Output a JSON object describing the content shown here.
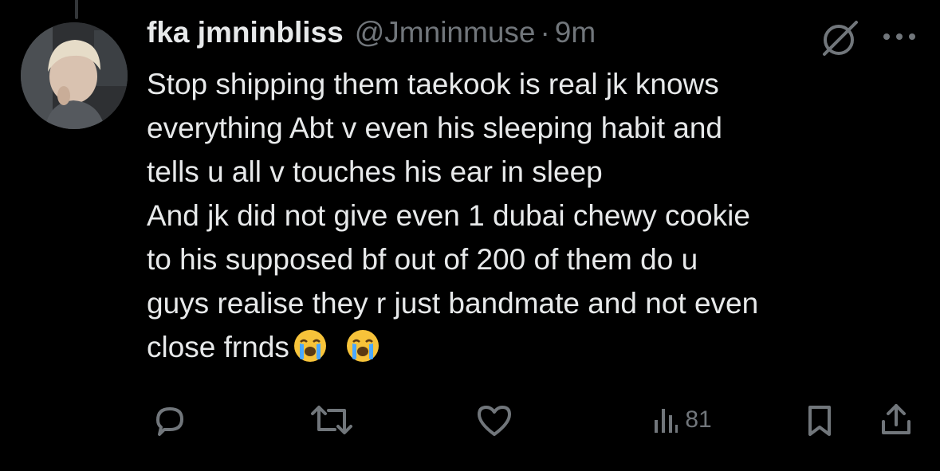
{
  "tweet": {
    "display_name": "fka jmninbliss",
    "handle": "@Jmninmuse",
    "separator": "·",
    "time": "9m",
    "lines": [
      "Stop shipping them taekook is real jk knows",
      "everything Abt v even his sleeping habit and",
      "tells u all v touches his ear in sleep",
      "And jk did not give even 1 dubai chewy cookie",
      "to his supposed bf out of 200 of them do u",
      "guys realise they r just bandmate and not even",
      "close frnds"
    ],
    "emojis": [
      "😭",
      "😭"
    ],
    "emoji_name": "loudly-crying-face"
  },
  "actions": {
    "views_count": "81"
  },
  "colors": {
    "background": "#000000",
    "text": "#e7e9ea",
    "secondary": "#71767b",
    "emoji_face": "#f7c33a",
    "emoji_tears": "#4aa8ff"
  },
  "icons": {
    "muted": "mute-circle-slash-icon",
    "more": "more-dots-icon",
    "reply": "reply-bubble-icon",
    "retweet": "retweet-icon",
    "like": "heart-icon",
    "views": "views-bar-chart-icon",
    "bookmark": "bookmark-icon",
    "share": "share-upload-icon"
  }
}
